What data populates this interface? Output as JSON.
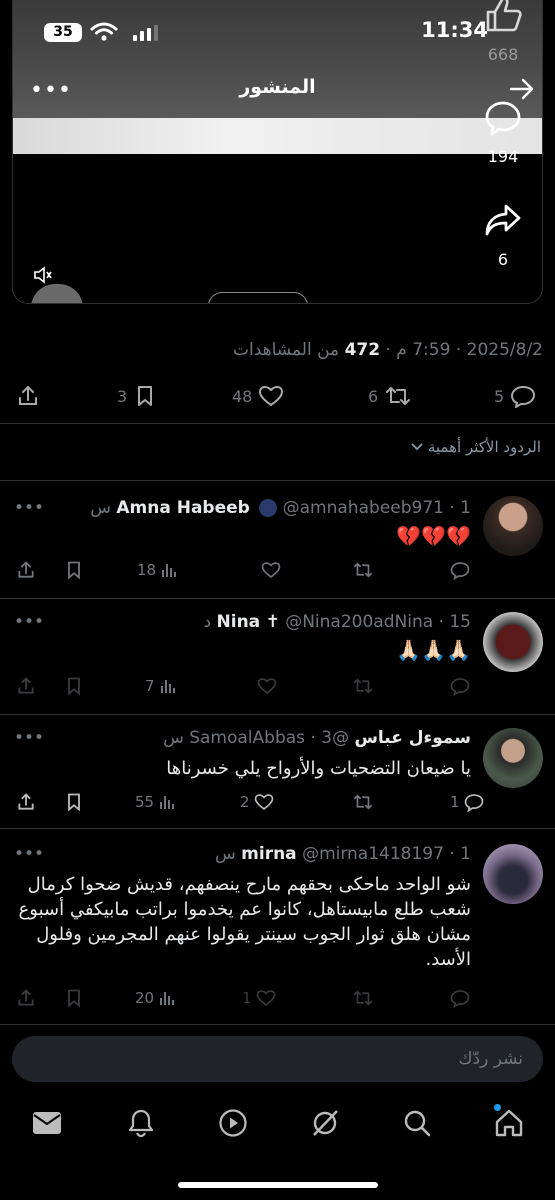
{
  "status_bar": {
    "time": "11:34",
    "battery": "35"
  },
  "header": {
    "title": "المنشور"
  },
  "overlay": {
    "likes": "668",
    "comments": "194",
    "shares": "6"
  },
  "post": {
    "date": "2025/8/2",
    "time": "7:59 م",
    "views_count": "472",
    "views_label": "من المشاهدات",
    "actions": {
      "replies": "5",
      "reposts": "6",
      "likes": "48",
      "bookmarks": "3"
    }
  },
  "sort_label": "الردود الأكثر أهمية",
  "replies": [
    {
      "name": "Amna Habeeb",
      "handle": "@amnahabeeb971",
      "time": "1 س",
      "text": "💔💔💔",
      "views": "18",
      "likes": "",
      "reposts": "",
      "comments": ""
    },
    {
      "name": "Nina",
      "handle": "@Nina200adNina",
      "time": "15 د",
      "text": "🙏🏻🙏🏻🙏🏻",
      "views": "7",
      "likes": "",
      "reposts": "",
      "comments": ""
    },
    {
      "name": "سموءل عباس",
      "handle": "@SamoalAbbas",
      "time": "3 س",
      "text": "يا ضيعان التضحيات والأرواح يلي خسرناها",
      "views": "55",
      "likes": "2",
      "reposts": "",
      "comments": "1"
    },
    {
      "name": "mirna",
      "handle": "@mirna1418197",
      "time": "1 س",
      "text": "شو الواحد ماحكى بحقهم مارح ينصفهم، قديش ضحوا كرمال شعب طلع مابيستاهل، كانوا عم يخدموا براتب مابيكفي أسبوع مشان هلق ثوار الجوب سينتر يقولوا عنهم المجرمين وفلول الأسد.",
      "views": "20",
      "likes": "1",
      "reposts": "",
      "comments": ""
    }
  ],
  "compose": {
    "placeholder": "نشر ردّك"
  },
  "tabs": [
    "messages-icon",
    "notifications-icon",
    "video-icon",
    "grok-icon",
    "search-icon",
    "home-icon"
  ]
}
